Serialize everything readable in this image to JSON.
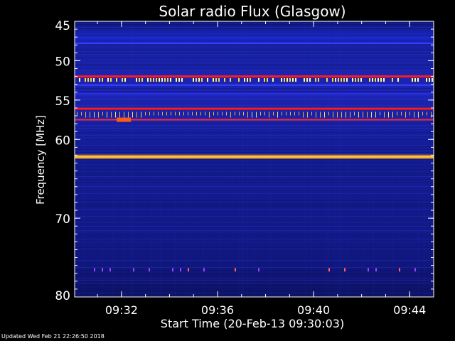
{
  "footer": "Updated Wed Feb 21 22:26:50 2018",
  "chart_data": {
    "type": "heatmap",
    "title": "Solar radio Flux (Glasgow)",
    "xlabel": "Start Time (20-Feb-13 09:30:03)",
    "ylabel": "Frequency [MHz]",
    "x_start": "09:30:03",
    "x_end": "09:45:00",
    "xlim_minutes": [
      30.05,
      45.0
    ],
    "x_ticks": [
      {
        "label": "09:32",
        "minute": 32
      },
      {
        "label": "09:36",
        "minute": 36
      },
      {
        "label": "09:40",
        "minute": 40
      },
      {
        "label": "09:44",
        "minute": 44
      }
    ],
    "ylim": [
      45,
      80
    ],
    "y_inverted": true,
    "y_ticks": [
      45,
      50,
      55,
      60,
      70,
      80
    ],
    "y_tick_labels": [
      "45",
      "50",
      "55",
      "60",
      "70",
      "80"
    ],
    "colormap": [
      "#0a0a5a",
      "#1a22b8",
      "#3b3bff",
      "#ff2020",
      "#ffd24a",
      "#ffff99"
    ],
    "background_color": "#141d8c",
    "bands": [
      {
        "freq": 47.8,
        "type": "line",
        "color": "#3a40ff",
        "intensity": 0.3
      },
      {
        "freq": 52.0,
        "type": "line",
        "color": "#ff1a1a",
        "intensity": 1.0
      },
      {
        "freq": 52.4,
        "type": "bursts",
        "color": "#ffd24a",
        "intensity": 0.8
      },
      {
        "freq": 53.1,
        "type": "line",
        "color": "#3a40ff",
        "intensity": 0.5
      },
      {
        "freq": 54.2,
        "type": "line",
        "color": "#2b30e8",
        "intensity": 0.4
      },
      {
        "freq": 56.1,
        "type": "line",
        "color": "#ff1a1a",
        "intensity": 1.0
      },
      {
        "freq": 56.5,
        "type": "ticks",
        "color": "#ffb030",
        "intensity": 0.7
      },
      {
        "freq": 57.5,
        "type": "line",
        "color": "#ff2a2a",
        "intensity": 0.8
      },
      {
        "freq": 62.2,
        "type": "line",
        "color": "#ffd030",
        "intensity": 1.0
      },
      {
        "freq": 76.5,
        "type": "specks",
        "color": "#ff4040",
        "intensity": 0.4
      }
    ]
  }
}
